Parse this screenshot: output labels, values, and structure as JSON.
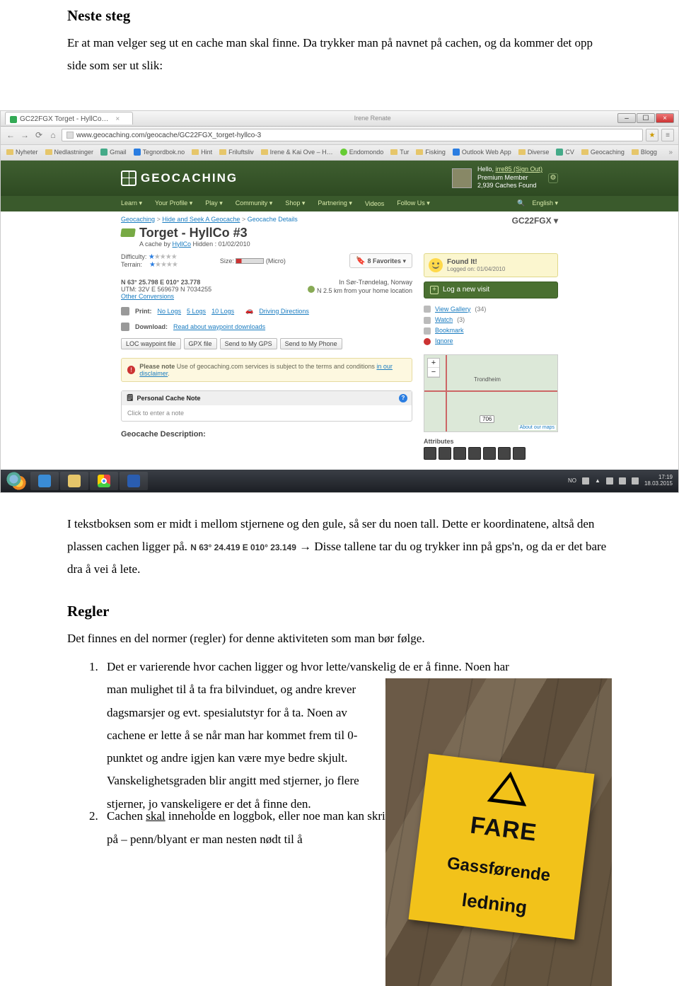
{
  "doc": {
    "h_neste": "Neste steg",
    "p_neste": "Er at man velger seg ut en cache man skal finne. Da trykker man på navnet på cachen, og da kommer det opp side som ser ut slik:",
    "p_after_shot_1a": "I tekstboksen som er midt i mellom stjernene og den gule, så ser du noen tall. Dette er koordinatene, altså den plassen cachen ligger på. ",
    "coords_inline": "N 63° 24.419 E 010° 23.149",
    "p_after_shot_1b": "   →  Disse tallene tar du og trykker inn på gps'n, og da er det bare dra å vei å lete.",
    "h_regler": "Regler",
    "p_regler": "Det finnes en del normer (regler) for denne aktiviteten som man bør følge.",
    "li1_a": "Det er varierende hvor cachen ligger og hvor lette/vanskelig de er å finne. Noen har ",
    "li1_b": "man mulighet til å ta fra bilvinduet, og andre krever dagsmarsjer og evt. spesialutstyr for å ta. Noen av cachene er lette å se når man har kommet frem til 0-punktet og andre igjen kan være mye bedre skjult. Vanskelighetsgraden blir angitt med stjerner, jo flere stjerner, jo vanskeligere er det å finne den.",
    "li2_a": "Cachen ",
    "li2_skal": "skal",
    "li2_b": " inneholde en loggbok, eller noe man kan skrive på – penn/blyant er man nesten nødt til å"
  },
  "sign": {
    "l1": "FARE",
    "l2": "Gassførende",
    "l3": "ledning"
  },
  "browser": {
    "tab": "GC22FGX Torget - HyllCo…",
    "url": "www.geocaching.com/geocache/GC22FGX_torget-hyllco-3",
    "user_label": "Irene Renate",
    "bookmarks": [
      "Nyheter",
      "Nedlastninger",
      "Gmail",
      "Tegnordbok.no",
      "Hint",
      "Friluftsliv",
      "Irene & Kai Ove – H…",
      "Endomondo",
      "Tur",
      "Fisking",
      "Outlook Web App",
      "Diverse",
      "CV",
      "Geocaching",
      "Blogg"
    ]
  },
  "gc": {
    "logo": "GEOCACHING",
    "hello": "Hello, ",
    "user": "irre85",
    "signout": " (Sign Out)",
    "member": "Premium Member",
    "found": "2,939 Caches Found",
    "nav": [
      "Learn ▾",
      "Your Profile ▾",
      "Play ▾",
      "Community ▾",
      "Shop ▾",
      "Partnering ▾",
      "Videos",
      "Follow Us ▾"
    ],
    "lang": "English ▾",
    "crumbs": {
      "a": "Geocaching",
      "b": "Hide and Seek A Geocache",
      "c": "Geocache Details"
    },
    "code": "GC22FGX ▾",
    "title": "Torget - HyllCo #3",
    "byline_a": "A cache by ",
    "byline_user": "HyllCo",
    "byline_b": "    Hidden : 01/02/2010",
    "diff_label": "Difficulty:",
    "terr_label": "Terrain:",
    "size_label": "Size:",
    "size_val": "(Micro)",
    "fav": "8 Favorites",
    "coord1": "N 63° 25.798 E 010° 23.778",
    "coord2": "UTM: 32V E 569679 N 7034255",
    "otherconv": "Other Conversions",
    "region": "In Sør-Trøndelag, Norway",
    "distance": "N 2.5 km from your home location",
    "print": "Print:",
    "print_links": [
      "No Logs",
      "5 Logs",
      "10 Logs"
    ],
    "driving": "Driving Directions",
    "download": "Download:",
    "download_link": "Read about waypoint downloads",
    "dl_btns": [
      "LOC waypoint file",
      "GPX file",
      "Send to My GPS",
      "Send to My Phone"
    ],
    "notice_a": "Please note",
    "notice_b": " Use of geocaching.com services is subject to the terms and conditions ",
    "notice_c": "in our disclaimer",
    "pnote_hd": "Personal Cache Note",
    "pnote_bd": "Click to enter a note",
    "desc_hd": "Geocache Description:",
    "found_t": "Found It!",
    "found_d": "Logged on: 01/04/2010",
    "log_btn": "Log a new visit",
    "rlinks": {
      "gallery": "View Gallery",
      "gallery_n": "(34)",
      "watch": "Watch",
      "watch_n": "(3)",
      "bookmark": "Bookmark",
      "ignore": "Ignore"
    },
    "map_city": "Trondheim",
    "map_badge": "706",
    "map_about": "About our maps",
    "attr_hd": "Attributes"
  },
  "tray": {
    "lang": "NO",
    "time": "17:19",
    "date": "18.03.2015"
  }
}
